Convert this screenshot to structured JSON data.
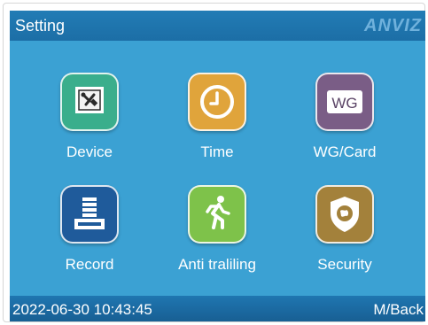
{
  "header": {
    "title": "Setting",
    "brand": "ANVIZ"
  },
  "menu": {
    "items": [
      {
        "label": "Device",
        "icon": "device-icon",
        "color": "#3aae8c"
      },
      {
        "label": "Time",
        "icon": "clock-icon",
        "color": "#e0a43b"
      },
      {
        "label": "WG/Card",
        "icon": "wg-card-icon",
        "color": "#7a5d86",
        "icon_text": "WG"
      },
      {
        "label": "Record",
        "icon": "record-icon",
        "color": "#1f5b9b"
      },
      {
        "label": "Anti traliling",
        "icon": "running-person-icon",
        "color": "#7ec24a"
      },
      {
        "label": "Security",
        "icon": "shield-icon",
        "color": "#a3813b"
      }
    ]
  },
  "footer": {
    "datetime": "2022-06-30 10:43:45",
    "back_label": "M/Back"
  }
}
